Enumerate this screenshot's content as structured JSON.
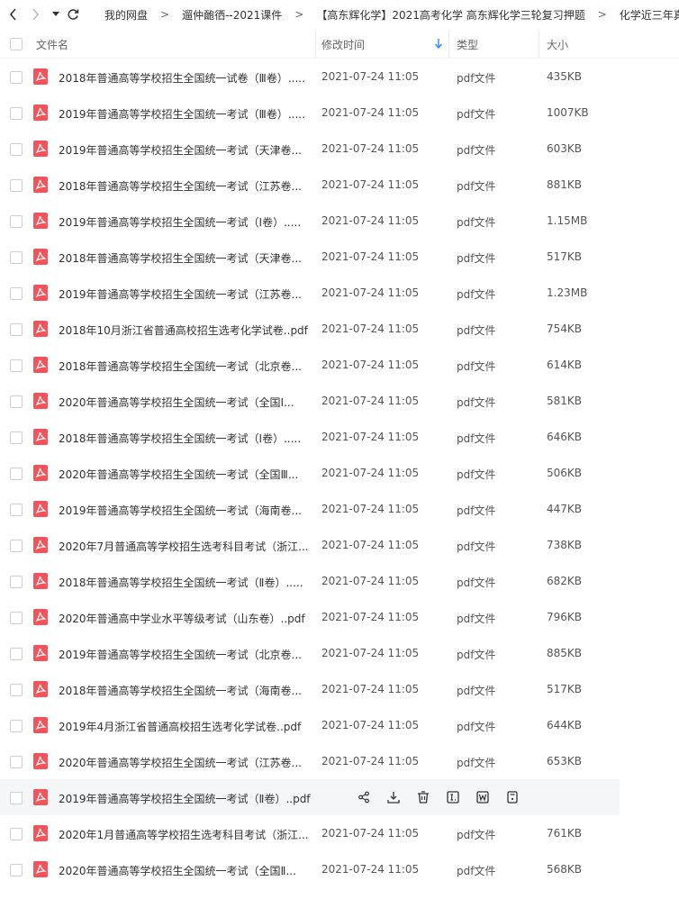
{
  "breadcrumb": [
    "我的网盘",
    "遛仲靤徆--2021课件",
    "【高东辉化学】2021高考化学 高东辉化学三轮复习押题",
    "化学近三年真题"
  ],
  "breadcrumb_sep": ">",
  "header": {
    "name": "文件名",
    "time": "修改时间",
    "type": "类型",
    "size": "大小"
  },
  "files": [
    {
      "name": "2018年普通高等学校招生全国统一试卷（Ⅲ卷）.....",
      "time": "2021-07-24 11:05",
      "type": "pdf文件",
      "size": "435KB"
    },
    {
      "name": "2019年普通高等学校招生全国统一考试（Ⅲ卷）.....",
      "time": "2021-07-24 11:05",
      "type": "pdf文件",
      "size": "1007KB"
    },
    {
      "name": "2019年普通高等学校招生全国统一考试（天津卷...",
      "time": "2021-07-24 11:05",
      "type": "pdf文件",
      "size": "603KB"
    },
    {
      "name": "2018年普通高等学校招生全国统一考试（江苏卷...",
      "time": "2021-07-24 11:05",
      "type": "pdf文件",
      "size": "881KB"
    },
    {
      "name": "2019年普通高等学校招生全国统一考试（Ⅰ卷）.....",
      "time": "2021-07-24 11:05",
      "type": "pdf文件",
      "size": "1.15MB"
    },
    {
      "name": "2018年普通高等学校招生全国统一考试（天津卷...",
      "time": "2021-07-24 11:05",
      "type": "pdf文件",
      "size": "517KB"
    },
    {
      "name": "2019年普通高等学校招生全国统一考试（江苏卷...",
      "time": "2021-07-24 11:05",
      "type": "pdf文件",
      "size": "1.23MB"
    },
    {
      "name": "2018年10月浙江省普通高校招生选考化学试卷..pdf",
      "time": "2021-07-24 11:05",
      "type": "pdf文件",
      "size": "754KB"
    },
    {
      "name": "2018年普通高等学校招生全国统一考试（北京卷...",
      "time": "2021-07-24 11:05",
      "type": "pdf文件",
      "size": "614KB"
    },
    {
      "name": "2020年普通高等学校招生全国统一考试（全国Ⅰ...",
      "time": "2021-07-24 11:05",
      "type": "pdf文件",
      "size": "581KB"
    },
    {
      "name": "2018年普通高等学校招生全国统一考试（Ⅰ卷）.....",
      "time": "2021-07-24 11:05",
      "type": "pdf文件",
      "size": "646KB"
    },
    {
      "name": "2020年普通高等学校招生全国统一考试（全国Ⅲ...",
      "time": "2021-07-24 11:05",
      "type": "pdf文件",
      "size": "506KB"
    },
    {
      "name": "2019年普通高等学校招生全国统一考试（海南卷...",
      "time": "2021-07-24 11:05",
      "type": "pdf文件",
      "size": "447KB"
    },
    {
      "name": "2020年7月普通高等学校招生选考科目考试（浙江...",
      "time": "2021-07-24 11:05",
      "type": "pdf文件",
      "size": "738KB"
    },
    {
      "name": "2018年普通高等学校招生全国统一考试（Ⅱ卷）.....",
      "time": "2021-07-24 11:05",
      "type": "pdf文件",
      "size": "682KB"
    },
    {
      "name": "2020年普通高中学业水平等级考试（山东卷）..pdf",
      "time": "2021-07-24 11:05",
      "type": "pdf文件",
      "size": "796KB"
    },
    {
      "name": "2019年普通高等学校招生全国统一考试（北京卷...",
      "time": "2021-07-24 11:05",
      "type": "pdf文件",
      "size": "885KB"
    },
    {
      "name": "2018年普通高等学校招生全国统一考试（海南卷...",
      "time": "2021-07-24 11:05",
      "type": "pdf文件",
      "size": "517KB"
    },
    {
      "name": "2019年4月浙江省普通高校招生选考化学试卷..pdf",
      "time": "2021-07-24 11:05",
      "type": "pdf文件",
      "size": "644KB"
    },
    {
      "name": "2020年普通高等学校招生全国统一考试（江苏卷...",
      "time": "2021-07-24 11:05",
      "type": "pdf文件",
      "size": "653KB"
    },
    {
      "name": "2019年普通高等学校招生全国统一考试（Ⅱ卷）..pdf",
      "time": "",
      "type": "",
      "size": "",
      "hover": true
    },
    {
      "name": "2020年1月普通高等学校招生选考科目考试（浙江...",
      "time": "2021-07-24 11:05",
      "type": "pdf文件",
      "size": "761KB"
    },
    {
      "name": "2020年普通高等学校招生全国统一考试（全国Ⅱ...",
      "time": "2021-07-24 11:05",
      "type": "pdf文件",
      "size": "568KB"
    }
  ],
  "row_actions": [
    "share-icon",
    "download-icon",
    "delete-icon",
    "extract-text-icon",
    "convert-word-icon",
    "more-doc-icon"
  ],
  "colors": {
    "pdf_red": "#f2545b",
    "sort_blue": "#2f8cf5",
    "hover_bg": "#f5f6f7"
  }
}
